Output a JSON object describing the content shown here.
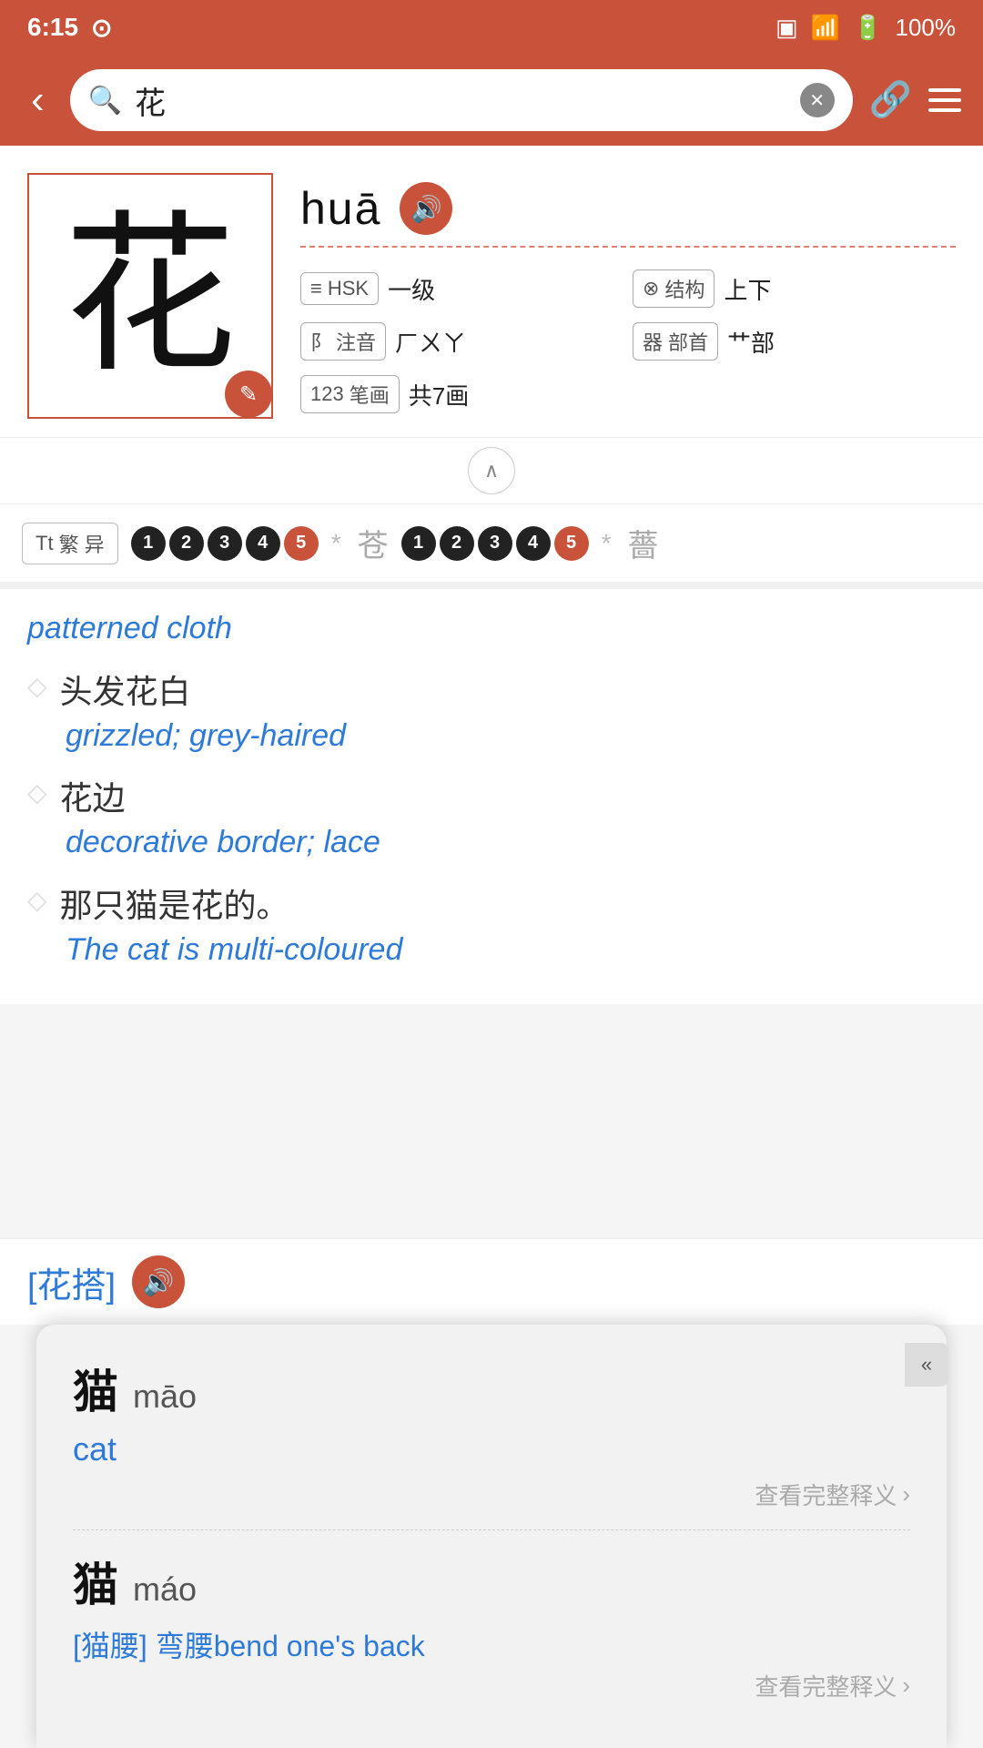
{
  "statusBar": {
    "time": "6:15",
    "battery": "100%"
  },
  "header": {
    "searchValue": "花",
    "backLabel": "‹",
    "clearLabel": "✕"
  },
  "charCard": {
    "character": "花",
    "pinyin": "huā",
    "hskLevel": "一级",
    "hskBadge": "HSK",
    "pronunciation": "ㄏㄨㄚ",
    "structure": "上下",
    "radical": "艹部",
    "strokes": "共7画",
    "editIcon": "✎"
  },
  "fontRow": {
    "label": "繁 异",
    "circles1": [
      "1",
      "2",
      "3",
      "4",
      "5"
    ],
    "variant1": "苍",
    "circles2": [
      "1",
      "2",
      "3",
      "4",
      "5"
    ],
    "variant2": "薔"
  },
  "definitions": [
    {
      "phrase": "",
      "english": "patterned cloth"
    },
    {
      "phrase": "头发花白",
      "english": "grizzled; grey-haired"
    },
    {
      "phrase": "花边",
      "english": "decorative border; lace"
    },
    {
      "phrase": "那只猫是花的。",
      "english": "The cat is multi-coloured"
    }
  ],
  "popup": {
    "collapseIcon": "«",
    "entries": [
      {
        "char": "猫",
        "pinyin": "māo",
        "meaning": "cat",
        "linkText": "查看完整释义",
        "linkArrow": "›"
      },
      {
        "char": "猫",
        "pinyin": "máo",
        "example_prefix": "[猫腰]",
        "example_text": " 弯腰bend one's back",
        "linkText": "查看完整释义",
        "linkArrow": "›"
      }
    ]
  },
  "bottomBar": {
    "phrase": "[花搭]",
    "audioIcon": "♪"
  }
}
